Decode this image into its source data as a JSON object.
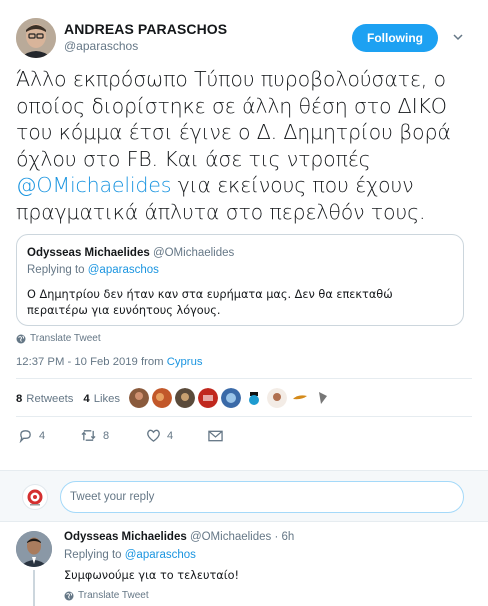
{
  "author": {
    "name": "ANDREAS PARASCHOS",
    "handle": "@aparaschos"
  },
  "follow_button": {
    "label": "Following",
    "color": "#1da1f2"
  },
  "tweet": {
    "text_before": "Άλλο εκπρόσωπο Τύπου πυροβολούσατε, ο οποίος διορίστηκε σε άλλη θέση στο ΔΙΚΟ του κόμμα έτσι έγινε ο Δ. Δημητρίου βορά όχλου στο FB. Και άσε τις ντροπές ",
    "mention": "@OMichaelides",
    "text_after": " για εκείνους που έχουν πραγματικά άπλυτα στο περελθόν τους."
  },
  "quoted": {
    "name": "Odysseas Michaelides",
    "handle": "@OMichaelides",
    "replying_to_label": "Replying to",
    "replying_to_handle": "@aparaschos",
    "text": "Ο Δημητρίου δεν ήταν καν στα ευρήματα μας. Δεν θα επεκταθώ περαιτέρω για ευνόητους λόγους."
  },
  "translate_label": "Translate Tweet",
  "timestamp": {
    "time_date": "12:37 PM - 10 Feb 2019 from ",
    "location": "Cyprus"
  },
  "stats": {
    "retweets_count": "8",
    "retweets_label": "Retweets",
    "likes_count": "4",
    "likes_label": "Likes"
  },
  "actions": {
    "reply_count": "4",
    "retweet_count": "8",
    "like_count": "4"
  },
  "reply_box": {
    "placeholder": "Tweet your reply"
  },
  "reply": {
    "name": "Odysseas Michaelides",
    "handle": "@OMichaelides",
    "time": "6h",
    "replying_to_label": "Replying to",
    "replying_to_handle": "@aparaschos",
    "text": "Συμφωνούμε για το τελευταίο!",
    "translate_label": "Translate Tweet"
  },
  "colors": {
    "link": "#1b95e0",
    "secondary_text": "#657786",
    "border": "#ccd6dd"
  }
}
